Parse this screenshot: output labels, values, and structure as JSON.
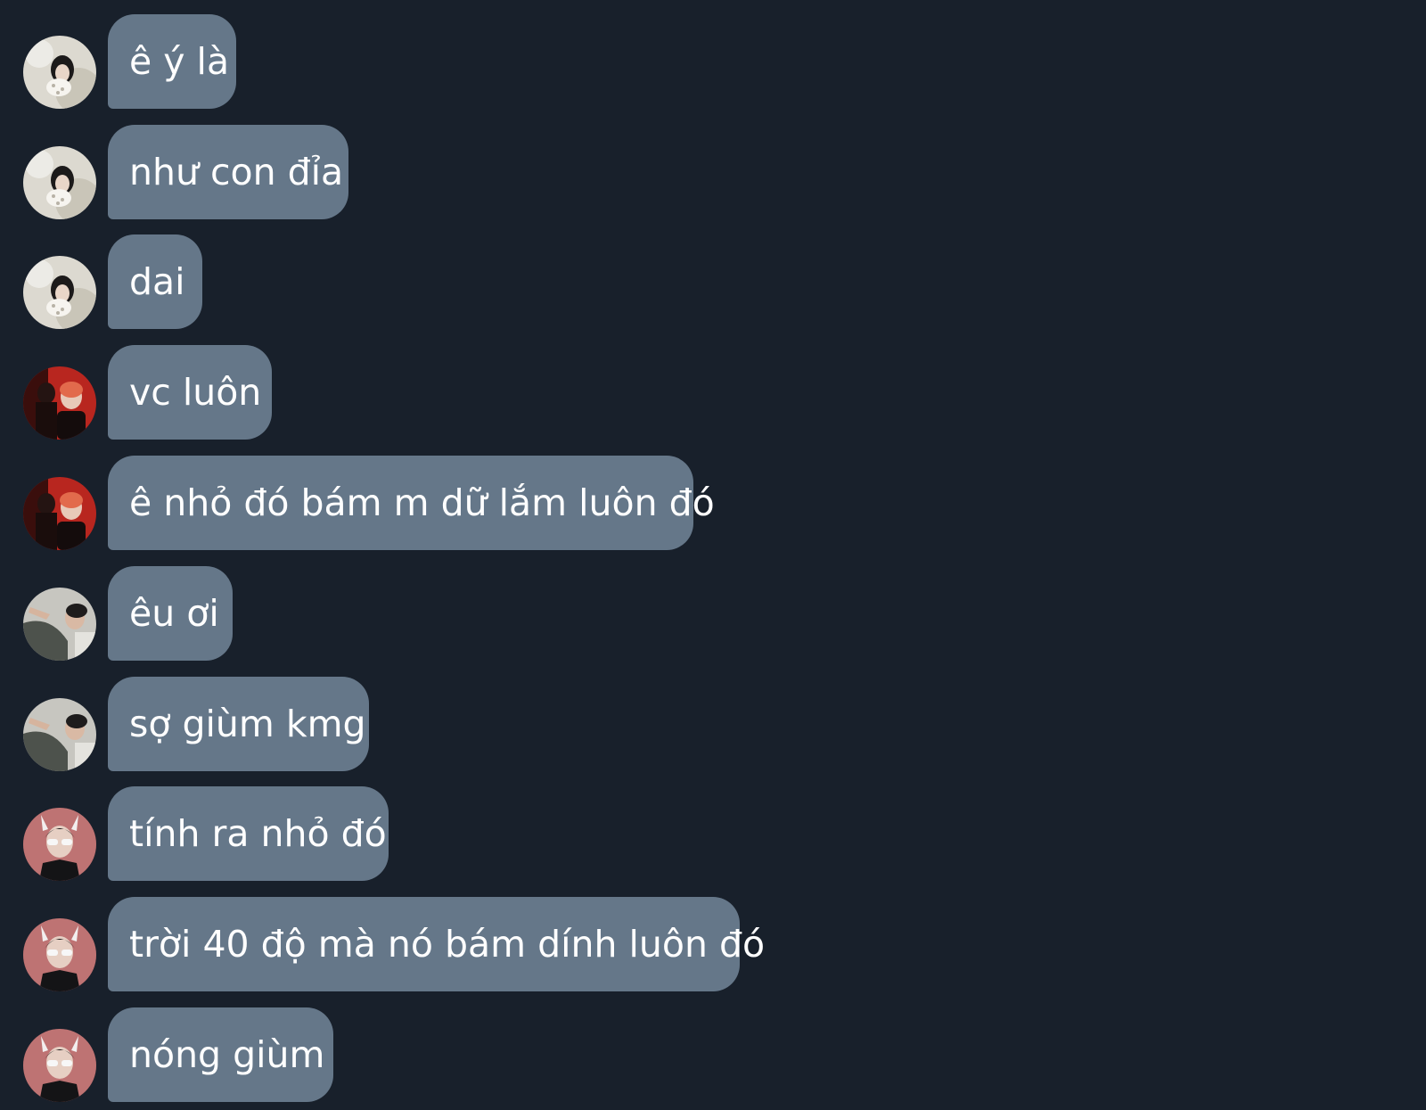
{
  "chat": {
    "background": "#18202b",
    "bubble_color": "#657789",
    "text_color": "#ffffff",
    "messages": [
      {
        "text": "ê ý là",
        "avatar": "user-a-avatar"
      },
      {
        "text": "như con đỉa",
        "avatar": "user-a-avatar"
      },
      {
        "text": "dai",
        "avatar": "user-a-avatar"
      },
      {
        "text": "vc luôn",
        "avatar": "user-b-avatar"
      },
      {
        "text": "ê nhỏ đó bám m dữ lắm luôn đó",
        "avatar": "user-b-avatar"
      },
      {
        "text": "êu ơi",
        "avatar": "user-c-avatar"
      },
      {
        "text": "sợ giùm kmg",
        "avatar": "user-c-avatar"
      },
      {
        "text": "tính ra nhỏ đó",
        "avatar": "user-d-avatar"
      },
      {
        "text": "trời 40 độ mà nó bám dính luôn đó",
        "avatar": "user-d-avatar"
      },
      {
        "text": "nóng giùm",
        "avatar": "user-d-avatar"
      }
    ]
  }
}
